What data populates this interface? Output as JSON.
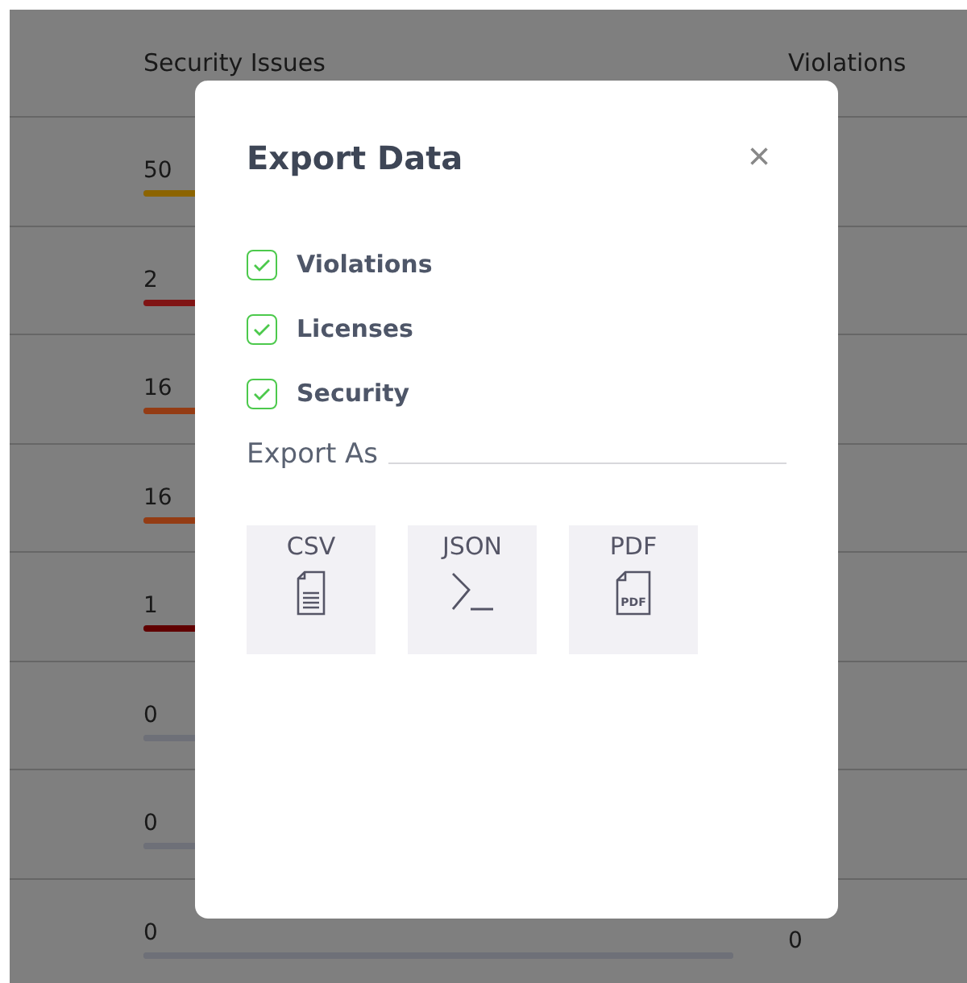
{
  "table": {
    "columns": [
      "Security Issues",
      "Violations"
    ],
    "rows": [
      {
        "security": "50",
        "color": "#8c6400"
      },
      {
        "security": "2",
        "color": "#801414"
      },
      {
        "security": "16",
        "color": "#943c14"
      },
      {
        "security": "16",
        "color": "#943c14"
      },
      {
        "security": "1",
        "color": "#600000"
      },
      {
        "security": "0",
        "color": "#6e7078"
      },
      {
        "security": "0",
        "color": "#6e7078"
      },
      {
        "security": "0",
        "color": "#6e7078",
        "violations": "0"
      }
    ]
  },
  "dialog": {
    "title": "Export Data",
    "close": "×",
    "options": [
      {
        "label": "Violations",
        "checked": true
      },
      {
        "label": "Licenses",
        "checked": true
      },
      {
        "label": "Security",
        "checked": true
      }
    ],
    "export_label": "Export As",
    "formats": [
      {
        "label": "CSV",
        "kind": "document"
      },
      {
        "label": "JSON",
        "kind": "terminal"
      },
      {
        "label": "PDF",
        "kind": "pdf",
        "icon_text": "PDF"
      }
    ]
  }
}
